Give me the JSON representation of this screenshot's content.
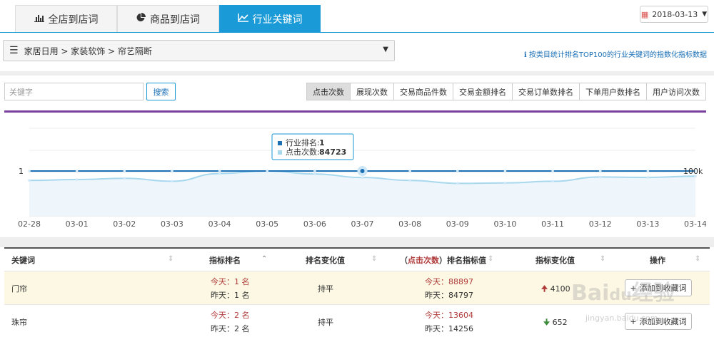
{
  "tabs": [
    {
      "label": "全店到店词",
      "icon": "bar-chart-icon"
    },
    {
      "label": "商品到店词",
      "icon": "pie-chart-icon"
    },
    {
      "label": "行业关键词",
      "icon": "line-chart-icon",
      "active": true
    }
  ],
  "date_picker": {
    "value": "2018-03-13"
  },
  "category": {
    "path": "家居日用 > 家装软饰 > 帘艺隔断"
  },
  "info_note": "按类目统计排名TOP100的行业关键词的指数化指标数据",
  "search": {
    "placeholder": "关键字",
    "button": "搜索"
  },
  "metric_tabs": [
    "点击次数",
    "展现次数",
    "交易商品件数",
    "交易金额排名",
    "交易订单数排名",
    "下单用户数排名",
    "用户访问次数"
  ],
  "active_metric": "点击次数",
  "colors": {
    "accent": "#1a9ad6",
    "purple_bar": "#7b3fa0",
    "rank_line": "#1a6fb5",
    "metric_line": "#a8d8ee",
    "up": "#b03a3a",
    "down": "#3a8a3a"
  },
  "chart_data": {
    "type": "line",
    "categories": [
      "02-28",
      "03-01",
      "03-02",
      "03-03",
      "03-04",
      "03-05",
      "03-06",
      "03-07",
      "03-08",
      "03-09",
      "03-10",
      "03-11",
      "03-12",
      "03-13",
      "03-14"
    ],
    "series": [
      {
        "name": "行业排名",
        "axis": "left",
        "values": [
          1,
          1,
          1,
          1,
          1,
          1,
          1,
          1,
          1,
          1,
          1,
          1,
          1,
          1,
          1
        ]
      },
      {
        "name": "点击次数",
        "axis": "right",
        "values": [
          78000,
          80000,
          83000,
          76000,
          94000,
          100000,
          93000,
          84723,
          78000,
          71000,
          72000,
          76000,
          86000,
          85000,
          88000
        ]
      }
    ],
    "left_axis_label": "1",
    "right_axis_label": "100k",
    "tooltip": {
      "rank_label": "行业排名:",
      "rank_value": "1",
      "metric_label": "点击次数:",
      "metric_value": "84723",
      "index": 7
    }
  },
  "table": {
    "headers": [
      "关键词",
      "指标排名",
      "排名变化值",
      "指标变化值",
      "操作"
    ],
    "header_metric_prefix": "（",
    "header_metric_name": "点击次数",
    "header_metric_suffix": "）排名指标值",
    "rows": [
      {
        "keyword": "门帘",
        "rank_today": "今天：1 名",
        "rank_yesterday": "昨天：1 名",
        "rank_change": "持平",
        "value_today": "今天：88897",
        "value_yesterday": "昨天：84797",
        "trend": "up",
        "value_change": "4100",
        "action": "添加到收藏词"
      },
      {
        "keyword": "珠帘",
        "rank_today": "今天：2 名",
        "rank_yesterday": "昨天：2 名",
        "rank_change": "持平",
        "value_today": "今天：13604",
        "value_yesterday": "昨天：14256",
        "trend": "down",
        "value_change": "652",
        "action": "添加到收藏词"
      }
    ]
  },
  "watermark": {
    "logo": "Baidu经验",
    "url": "jingyan.baidu.com"
  }
}
